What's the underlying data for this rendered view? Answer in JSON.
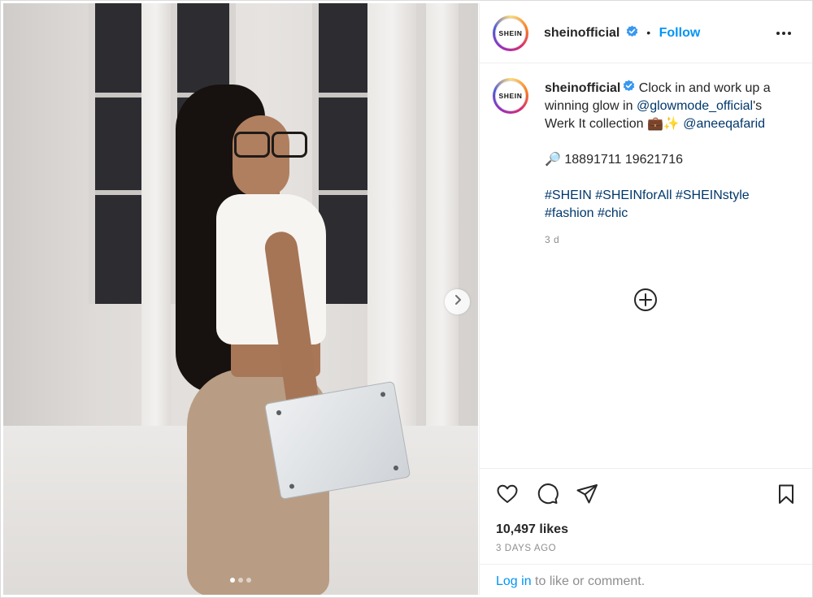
{
  "post": {
    "slide_dots": 3,
    "active_slide": 1
  },
  "header": {
    "avatar_text": "SHEIN",
    "username": "sheinofficial",
    "separator": "•",
    "follow_label": "Follow"
  },
  "caption": {
    "avatar_text": "SHEIN",
    "username": "sheinofficial",
    "text_1": " Clock in and work up a winning glow in ",
    "mention_1": "@glowmode_official",
    "text_2": "'s Werk It collection 💼✨ ",
    "mention_2": "@aneeqafarid",
    "codes": "🔎 18891711 19621716",
    "hashtags": [
      "#SHEIN",
      "#SHEINforAll",
      "#SHEINstyle",
      "#fashion",
      "#chic"
    ],
    "time": "3 d"
  },
  "stats": {
    "likes": "10,497 likes",
    "posted": "3 DAYS AGO"
  },
  "footer": {
    "login_link": "Log in",
    "login_text": " to like or comment."
  },
  "icons": [
    "verified-badge-icon",
    "more-options-icon",
    "chevron-right-icon",
    "add-circle-icon",
    "heart-icon",
    "comment-icon",
    "share-icon",
    "bookmark-icon"
  ],
  "colors": {
    "accent": "#0095f6",
    "verified": "#3897f0",
    "mention": "#00376b",
    "muted": "#8e8e8e"
  }
}
